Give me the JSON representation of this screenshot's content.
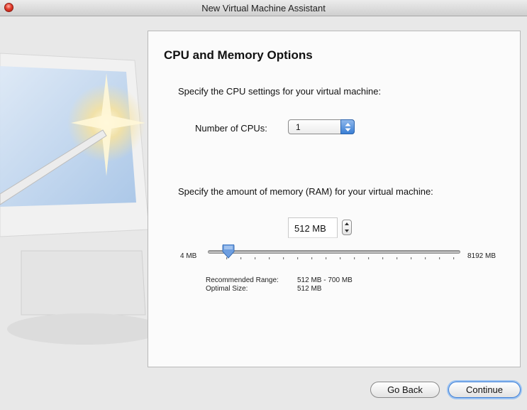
{
  "window": {
    "title": "New Virtual Machine Assistant"
  },
  "page": {
    "heading": "CPU and Memory Options"
  },
  "cpu": {
    "prompt": "Specify the CPU settings for your virtual machine:",
    "label": "Number of CPUs:",
    "selected": "1"
  },
  "memory": {
    "prompt": "Specify the amount of memory (RAM) for your virtual machine:",
    "value": "512 MB",
    "slider_min_label": "4 MB",
    "slider_max_label": "8192 MB",
    "slider_min_mb": 4,
    "slider_max_mb": 8192,
    "slider_value_mb": 512,
    "recommended_range_label": "Recommended Range:",
    "recommended_range_value": "512 MB - 700 MB",
    "optimal_size_label": "Optimal Size:",
    "optimal_size_value": "512 MB"
  },
  "buttons": {
    "back": "Go Back",
    "continue": "Continue"
  },
  "colors": {
    "accent": "#3a7ed4",
    "close": "#e23c2c"
  }
}
